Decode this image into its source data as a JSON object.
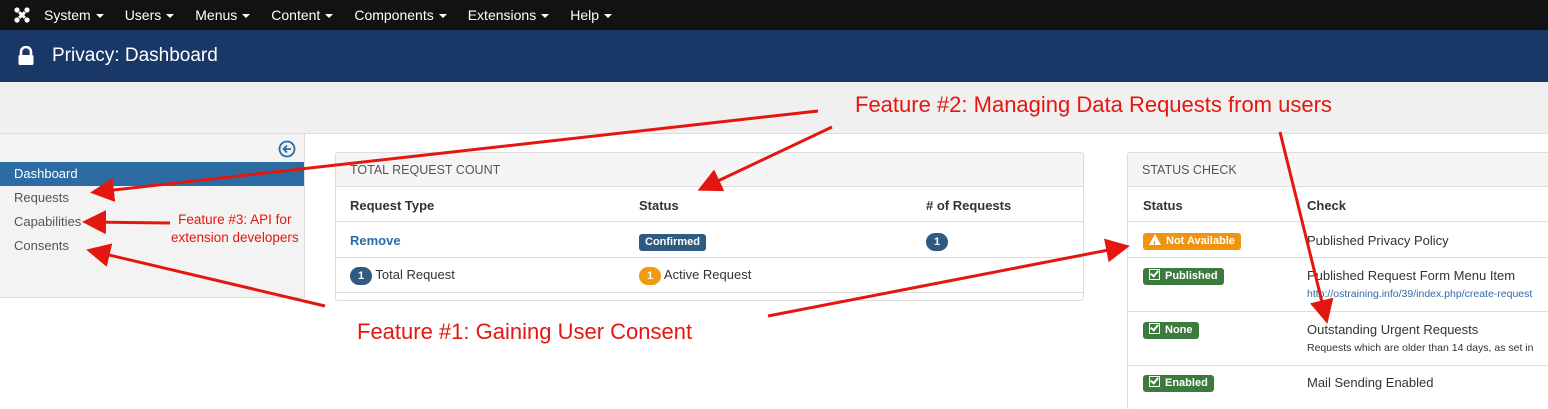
{
  "topnav": {
    "items": [
      "System",
      "Users",
      "Menus",
      "Content",
      "Components",
      "Extensions",
      "Help"
    ]
  },
  "titlebar": {
    "title": "Privacy: Dashboard"
  },
  "sidebar": {
    "items": [
      "Dashboard",
      "Requests",
      "Capabilities",
      "Consents"
    ],
    "active_index": 0
  },
  "total_request_panel": {
    "heading": "TOTAL REQUEST COUNT",
    "columns": [
      "Request Type",
      "Status",
      "# of Requests"
    ],
    "row": {
      "type": "Remove",
      "status": "Confirmed",
      "count": "1"
    },
    "footer": {
      "total_badge": "1",
      "total_label": "Total Request",
      "active_badge": "1",
      "active_label": "Active Request"
    }
  },
  "status_check_panel": {
    "heading": "STATUS CHECK",
    "columns": [
      "Status",
      "Check"
    ],
    "rows": [
      {
        "status": "Not Available",
        "check": "Published Privacy Policy",
        "detail": ""
      },
      {
        "status": "Published",
        "check": "Published Request Form Menu Item",
        "detail": "http://ostraining.info/39/index.php/create-request"
      },
      {
        "status": "None",
        "check": "Outstanding Urgent Requests",
        "detail": "Requests which are older than 14 days, as set in"
      },
      {
        "status": "Enabled",
        "check": "Mail Sending Enabled",
        "detail": ""
      }
    ]
  },
  "annotations": {
    "feature1": "Feature #1: Gaining User Consent",
    "feature2": "Feature #2: Managing Data Requests from users",
    "feature3_line1": "Feature #3: API for",
    "feature3_line2": "extension developers"
  },
  "colors": {
    "nav_bg": "#121212",
    "title_bg": "#1a3867",
    "active_item": "#2d6ca2",
    "annotation": "#e3170f",
    "label_green": "#3d7a3d",
    "label_orange": "#f0930d",
    "badge_blue": "#2f5b82"
  }
}
